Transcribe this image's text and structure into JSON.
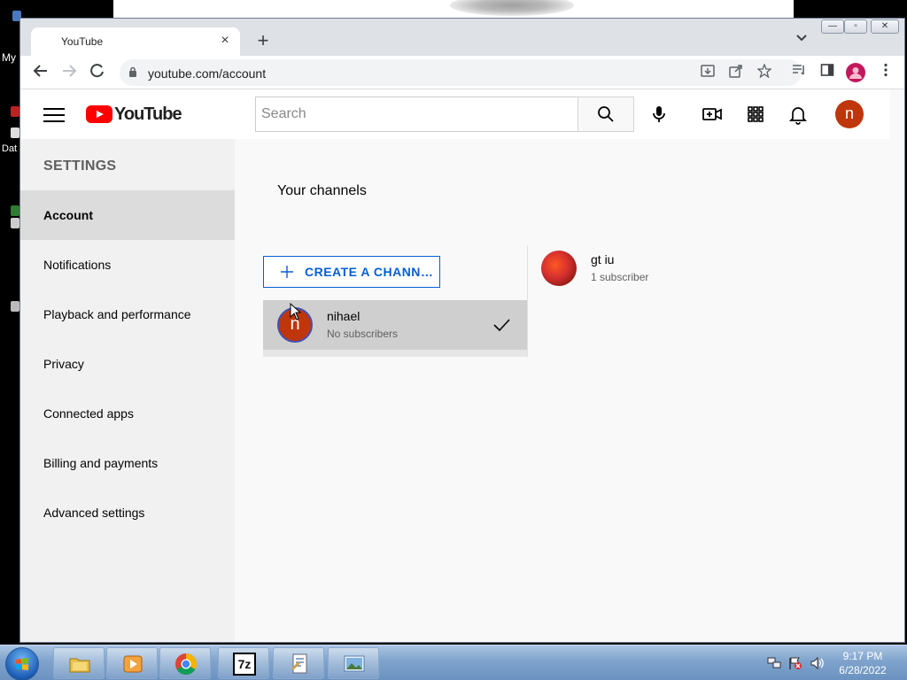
{
  "desktop": {
    "labels": [
      "My",
      "Dat"
    ]
  },
  "browser": {
    "tab_title": "YouTube",
    "url": "youtube.com/account",
    "window_controls": {
      "minimize": "—",
      "maximize": "▫",
      "close": "✕"
    }
  },
  "youtube": {
    "brand": "YouTube",
    "search_placeholder": "Search",
    "avatar_letter": "n",
    "settings": {
      "heading": "SETTINGS",
      "items": [
        {
          "label": "Account",
          "active": true
        },
        {
          "label": "Notifications",
          "active": false
        },
        {
          "label": "Playback and performance",
          "active": false
        },
        {
          "label": "Privacy",
          "active": false
        },
        {
          "label": "Connected apps",
          "active": false
        },
        {
          "label": "Billing and payments",
          "active": false
        },
        {
          "label": "Advanced settings",
          "active": false
        }
      ]
    },
    "channels": {
      "title": "Your channels",
      "create_button": "CREATE A CHANN…",
      "list": [
        {
          "name": "nihael",
          "subscribers": "No subscribers",
          "avatar_letter": "n",
          "selected": true
        },
        {
          "name": "gt iu",
          "subscribers": "1 subscriber",
          "selected": false
        }
      ]
    }
  },
  "taskbar": {
    "apps": [
      "explorer-icon",
      "media-player-icon",
      "chrome-icon",
      "7zip-icon",
      "document-icon",
      "photo-viewer-icon"
    ],
    "icon_7zip": "7z",
    "clock": {
      "time": "9:17 PM",
      "date": "6/28/2022"
    }
  },
  "colors": {
    "yt_red": "#ff0000",
    "accent_blue": "#065fd4",
    "avatar": "#bf360c"
  }
}
